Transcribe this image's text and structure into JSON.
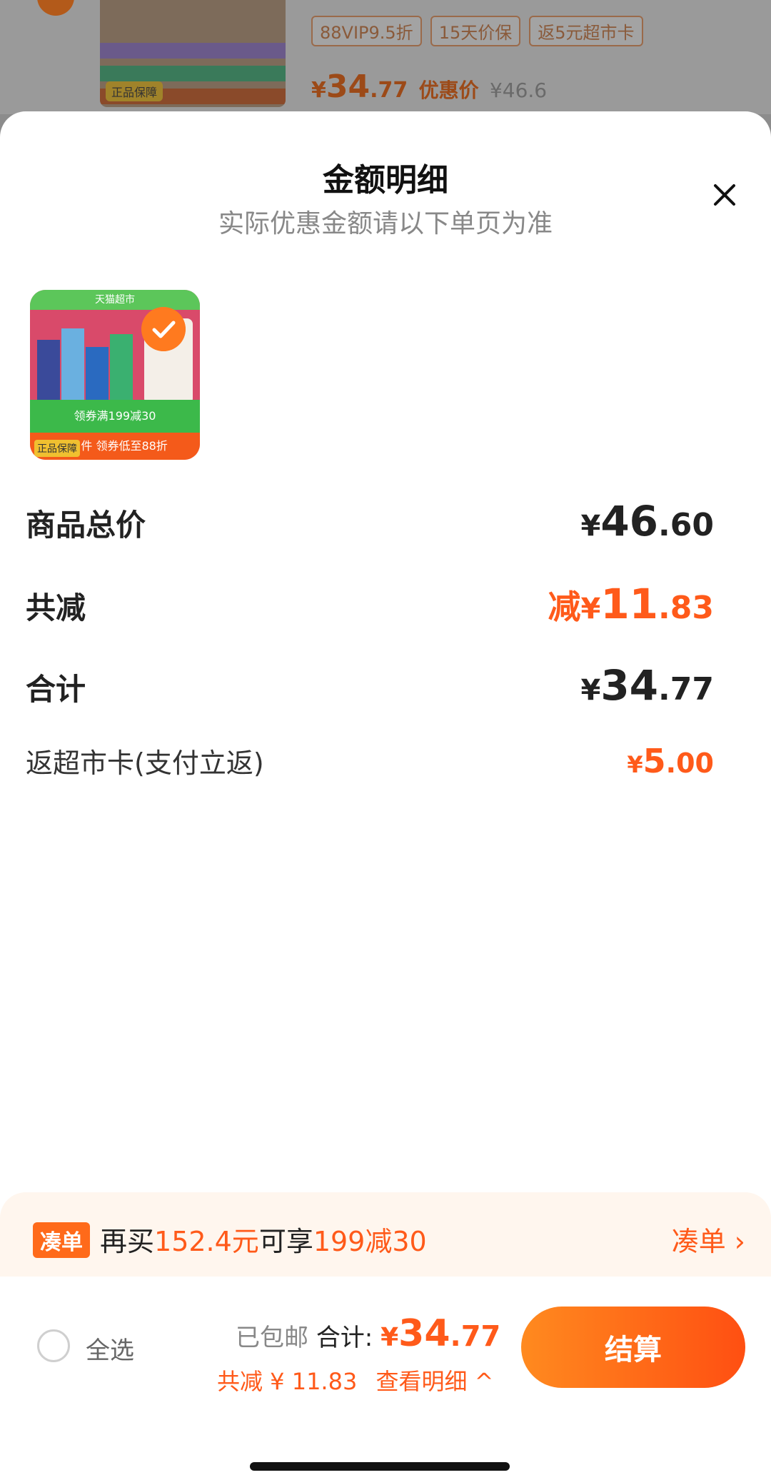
{
  "background": {
    "tags": [
      "88VIP9.5折",
      "15天价保",
      "返5元超市卡"
    ],
    "price": {
      "yen": "¥",
      "int": "34",
      "dec": ".77",
      "label": "优惠价",
      "original": "¥46.6"
    },
    "thumb_badge": "正品保障"
  },
  "sheet": {
    "title": "金额明细",
    "subtitle": "实际优惠金额请以下单页为准"
  },
  "thumb": {
    "top_text": "天猫超市",
    "green_text": "领券满199减30",
    "orange_text": "拍5件 领券低至88折",
    "badge": "正品保障"
  },
  "rows": [
    {
      "label": "商品总价",
      "prefix": "",
      "yen": "¥",
      "int": "46",
      "dec": ".60"
    },
    {
      "label": "共减",
      "prefix": "减",
      "yen": "¥",
      "int": "11",
      "dec": ".83"
    },
    {
      "label": "合计",
      "prefix": "",
      "yen": "¥",
      "int": "34",
      "dec": ".77"
    },
    {
      "label": "返超市卡(支付立返)",
      "prefix": "",
      "yen": "¥",
      "int": "5",
      "dec": ".00"
    }
  ],
  "promo": {
    "tag": "凑单",
    "text_a": "再买",
    "amount": "152.4元",
    "text_b": "可享",
    "deal": "199减30",
    "link": "凑单 ›"
  },
  "bottom": {
    "select_all": "全选",
    "shipped": "已包邮",
    "total_label": "合计:",
    "total_yen": "¥",
    "total_int": "34",
    "total_dec": ".77",
    "saved": "共减 ¥ 11.83",
    "detail": "查看明细 ^",
    "checkout": "结算"
  },
  "colors": {
    "accent": "#ff5a1a",
    "button_start": "#ff8a1f",
    "button_end": "#ff4f12"
  }
}
